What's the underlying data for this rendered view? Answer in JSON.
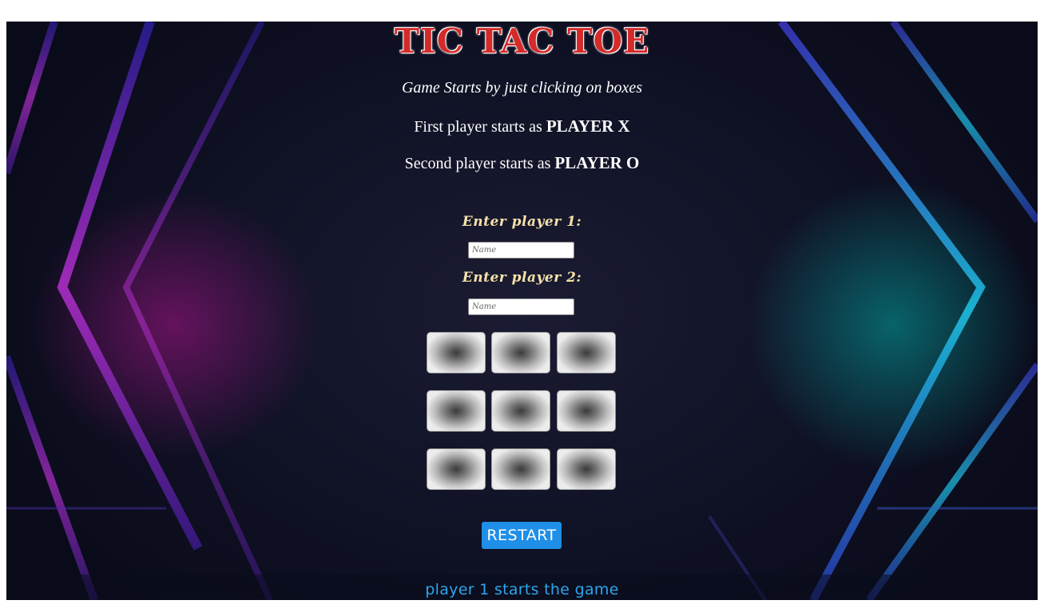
{
  "title": "TIC TAC TOE",
  "tagline": "Game Starts by just clicking on boxes",
  "info": {
    "first_prefix": "First player starts as ",
    "first_player": "PLAYER X",
    "second_prefix": "Second player starts as ",
    "second_player": "PLAYER O"
  },
  "inputs": {
    "player1_label": "Enter player 1:",
    "player1_placeholder": "Name",
    "player1_value": "",
    "player2_label": "Enter player 2:",
    "player2_placeholder": "Name",
    "player2_value": ""
  },
  "board": {
    "cells": [
      "",
      "",
      "",
      "",
      "",
      "",
      "",
      "",
      ""
    ]
  },
  "restart_label": "RESTART",
  "status": "player 1 starts the game",
  "colors": {
    "title": "#d42a2a",
    "label": "#f6e2a8",
    "button": "#1f8fe8",
    "status": "#2aa6ee",
    "left_glow": "#aa148c",
    "right_glow": "#00c8be"
  }
}
